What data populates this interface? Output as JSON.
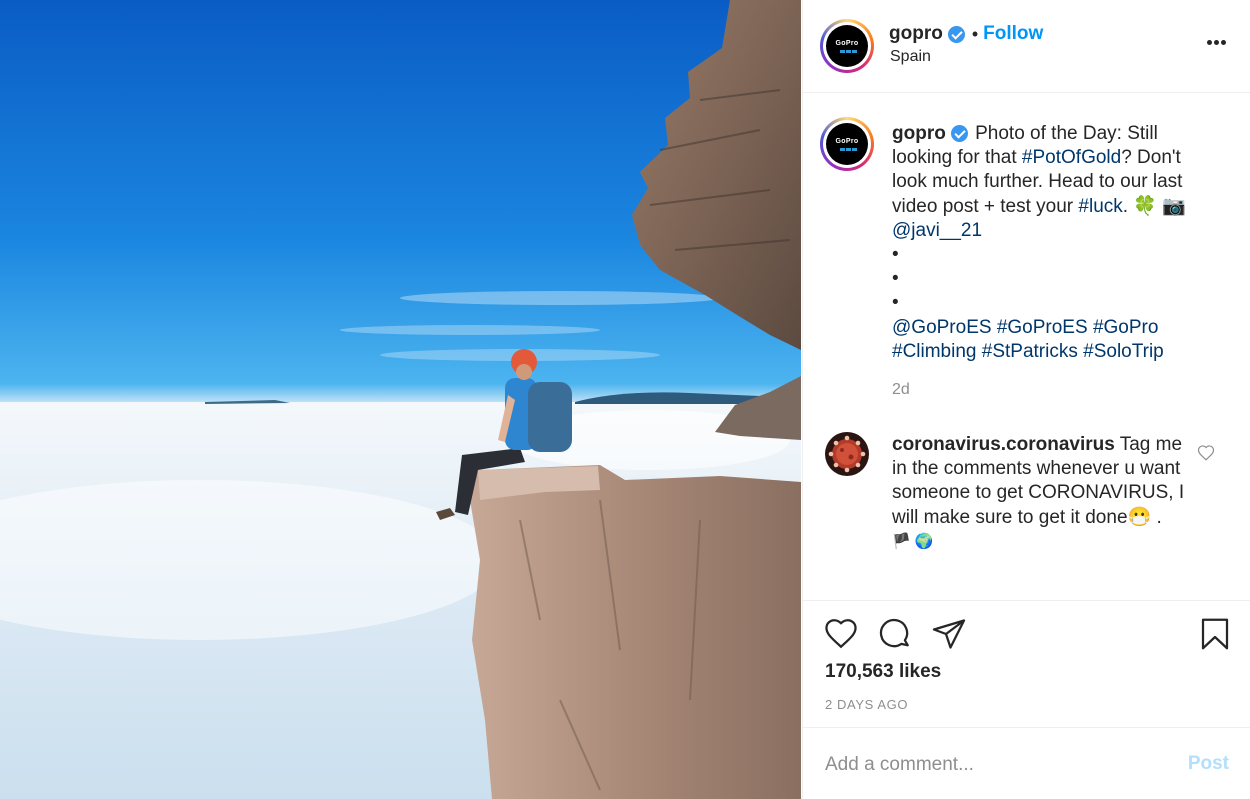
{
  "post": {
    "username": "gopro",
    "follow_label": "Follow",
    "dot": "•",
    "location": "Spain",
    "avatar_text": "GoPro"
  },
  "caption": {
    "username": "gopro",
    "parts": [
      {
        "text": " Photo of the Day: Still looking for that ",
        "tag": false
      },
      {
        "text": "#PotOfGold",
        "tag": true
      },
      {
        "text": "? Don't look much further. Head to our last video post + test your ",
        "tag": false
      },
      {
        "text": "#luck",
        "tag": true
      },
      {
        "text": ". 🍀 📷 ",
        "tag": false
      },
      {
        "text": "@javi__21",
        "tag": true
      }
    ],
    "bullets": [
      "•",
      "•",
      "•"
    ],
    "hashtags_line1": [
      "@GoProES",
      "#GoProES",
      "#GoPro"
    ],
    "hashtags_line2": [
      "#Climbing",
      "#StPatricks",
      "#SoloTrip"
    ],
    "time": "2d"
  },
  "comment": {
    "username": "coronavirus.coronavirus",
    "text": " Tag me in the comments whenever u want someone to get CORONAVIRUS, I will make sure to get it done😷 .",
    "emoji_line": "🏴 🌍"
  },
  "actions": {
    "icons": [
      "heart-icon",
      "comment-icon",
      "share-icon",
      "bookmark-icon"
    ],
    "likes": "170,563 likes",
    "posted": "2 DAYS AGO"
  },
  "add_comment": {
    "placeholder": "Add a comment...",
    "post_label": "Post"
  },
  "colors": {
    "link": "#00376b",
    "follow": "#0095f6",
    "verified": "#3897f0",
    "muted": "#8e8e8e",
    "post_disabled": "#b2dffc"
  }
}
